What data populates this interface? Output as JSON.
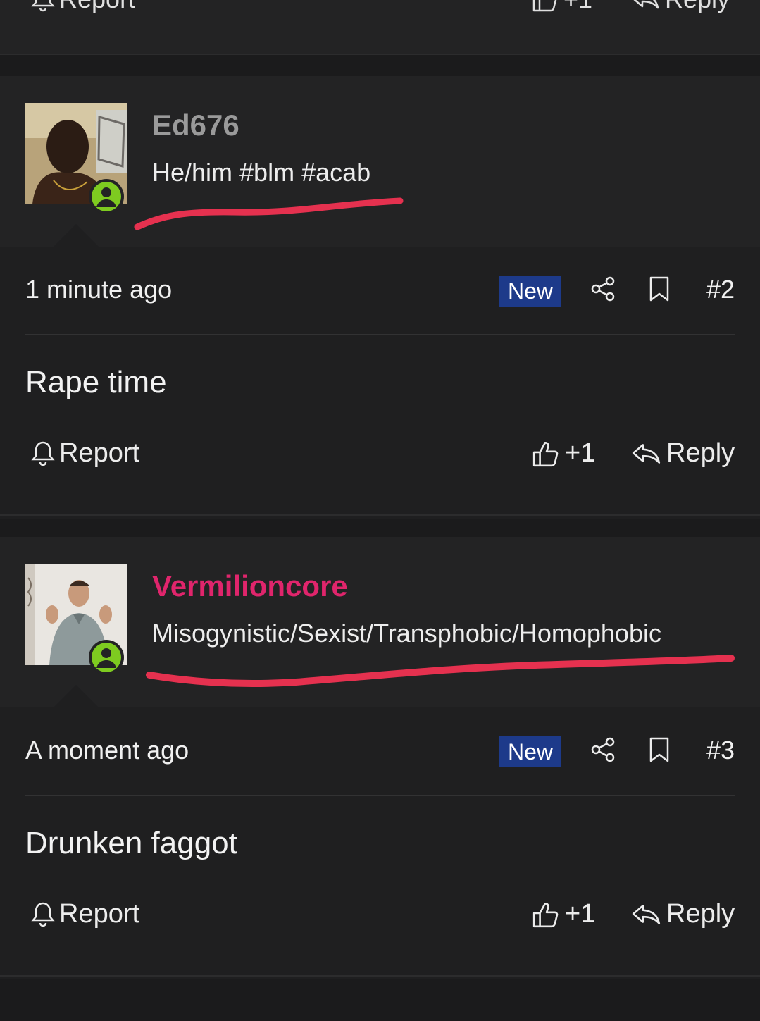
{
  "previous_post": {
    "report_label": "Report",
    "like_count": "+1",
    "reply_label": "Reply"
  },
  "posts": [
    {
      "author": "Ed676",
      "author_color": "#9a9a9a",
      "tagline": "He/him #blm #acab",
      "timestamp": "1 minute ago",
      "badge": "New",
      "post_number": "#2",
      "content": "Rape time",
      "report_label": "Report",
      "like_count": "+1",
      "reply_label": "Reply",
      "online": true
    },
    {
      "author": "Vermilioncore",
      "author_color": "#e0256c",
      "tagline": "Misogynistic/Sexist/Transphobic/Homophobic",
      "timestamp": "A moment ago",
      "badge": "New",
      "post_number": "#3",
      "content": "Drunken faggot",
      "report_label": "Report",
      "like_count": "+1",
      "reply_label": "Reply",
      "online": true
    }
  ],
  "colors": {
    "background": "#1b1b1c",
    "card": "#232324",
    "badge": "#1d3a8a",
    "online": "#7ecb20",
    "annotation": "#e5314f"
  },
  "icons": [
    "bell-icon",
    "thumbs-up-icon",
    "reply-arrow-icon",
    "share-icon",
    "bookmark-icon",
    "user-status-icon"
  ]
}
